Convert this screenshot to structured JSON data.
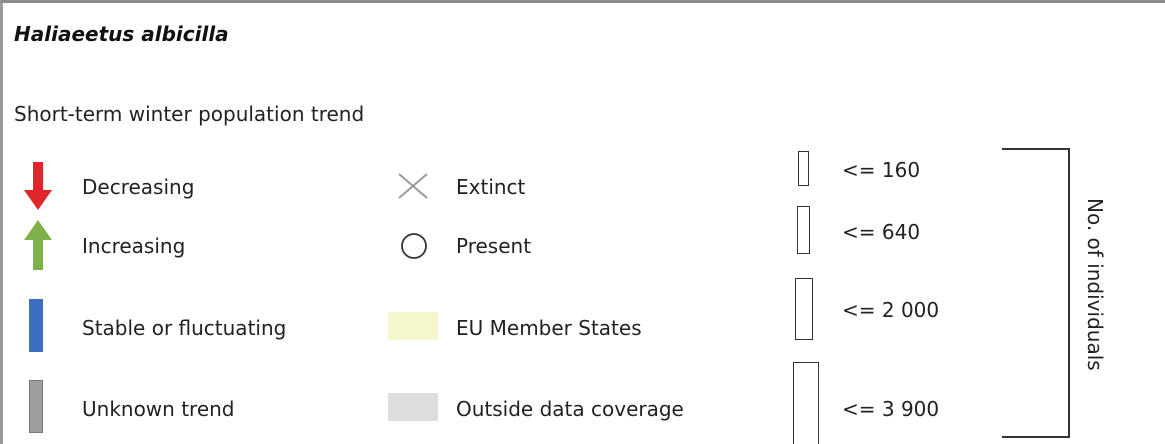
{
  "species": "Haliaeetus albicilla",
  "subtitle": "Short-term winter population trend",
  "trends": [
    {
      "label": "Decreasing",
      "color": "#e0262a",
      "icon": "arrow-down-icon"
    },
    {
      "label": "Increasing",
      "color": "#7fb04a",
      "icon": "arrow-up-icon"
    },
    {
      "label": "Stable or fluctuating",
      "color": "#3d6fc1",
      "icon": "blue-bar-icon"
    },
    {
      "label": "Unknown trend",
      "color": "#9e9e9e",
      "icon": "grey-bar-icon"
    }
  ],
  "status": [
    {
      "label": "Extinct",
      "icon": "cross-icon",
      "color": "#9a9a9a"
    },
    {
      "label": "Present",
      "icon": "circle-icon",
      "color": "#333333"
    },
    {
      "label": "EU Member States",
      "icon": "swatch-eu",
      "color": "#f4f7cc"
    },
    {
      "label": "Outside data coverage",
      "icon": "swatch-outside",
      "color": "#dedede"
    }
  ],
  "sizes": {
    "classes": [
      "<= 160",
      "<= 640",
      "<= 2 000",
      "<= 3 900"
    ],
    "axis_label": "No. of individuals"
  }
}
